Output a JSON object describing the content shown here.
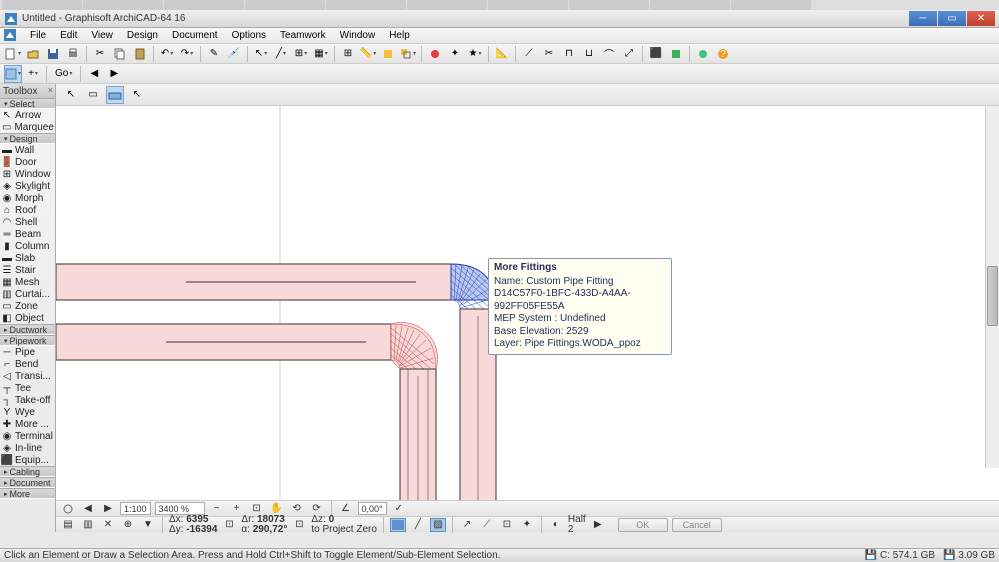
{
  "window": {
    "title": "Untitled - Graphisoft ArchiCAD-64 16"
  },
  "menu": {
    "items": [
      "File",
      "Edit",
      "View",
      "Design",
      "Document",
      "Options",
      "Teamwork",
      "Window",
      "Help"
    ]
  },
  "toolbox": {
    "title": "Toolbox",
    "sections": {
      "select": {
        "label": "Select",
        "tools": [
          "Arrow",
          "Marquee"
        ]
      },
      "design": {
        "label": "Design",
        "tools": [
          "Wall",
          "Door",
          "Window",
          "Skylight",
          "Morph",
          "Roof",
          "Shell",
          "Beam",
          "Column",
          "Slab",
          "Stair",
          "Mesh",
          "Curtai...",
          "Zone",
          "Object"
        ]
      },
      "ductwork": {
        "label": "Ductwork"
      },
      "pipework": {
        "label": "Pipework",
        "tools": [
          "Pipe",
          "Bend",
          "Transi...",
          "Tee",
          "Take-off",
          "Wye",
          "More ...",
          "Terminal",
          "In-line",
          "Equip..."
        ]
      },
      "cabling": {
        "label": "Cabling"
      },
      "document": {
        "label": "Document"
      },
      "more": {
        "label": "More"
      }
    }
  },
  "tooltip": {
    "title": "More Fittings",
    "name_label": "Name:",
    "name": "Custom Pipe Fitting D14C57F0-1BFC-433D-A4AA-992FF05FE55A",
    "system_label": "MEP System :",
    "system": "Undefined",
    "elevation_label": "Base Elevation:",
    "elevation": "2529",
    "layer_label": "Layer:",
    "layer": "Pipe Fittings.WODA_ppoz"
  },
  "bottom": {
    "scale": "1:100",
    "zoom": "3400 %",
    "angle": "0,00°",
    "dx_label": "Δx:",
    "dx": "6395",
    "dy_label": "Δy:",
    "dy": "-16394",
    "dr_label": "Δr:",
    "dr": "18073",
    "da_label": "α:",
    "da": "290,72°",
    "dz_label": "Δz:",
    "dz": "0",
    "ref_label": "to Project Zero",
    "seg_label": "Half",
    "seg_val": "2",
    "ok": "OK",
    "cancel": "Cancel"
  },
  "status": {
    "msg": "Click an Element or Draw a Selection Area. Press and Hold Ctrl+Shift to Toggle Element/Sub-Element Selection.",
    "disk_c": "C: 574.1 GB",
    "disk_other": "3.09 GB"
  }
}
